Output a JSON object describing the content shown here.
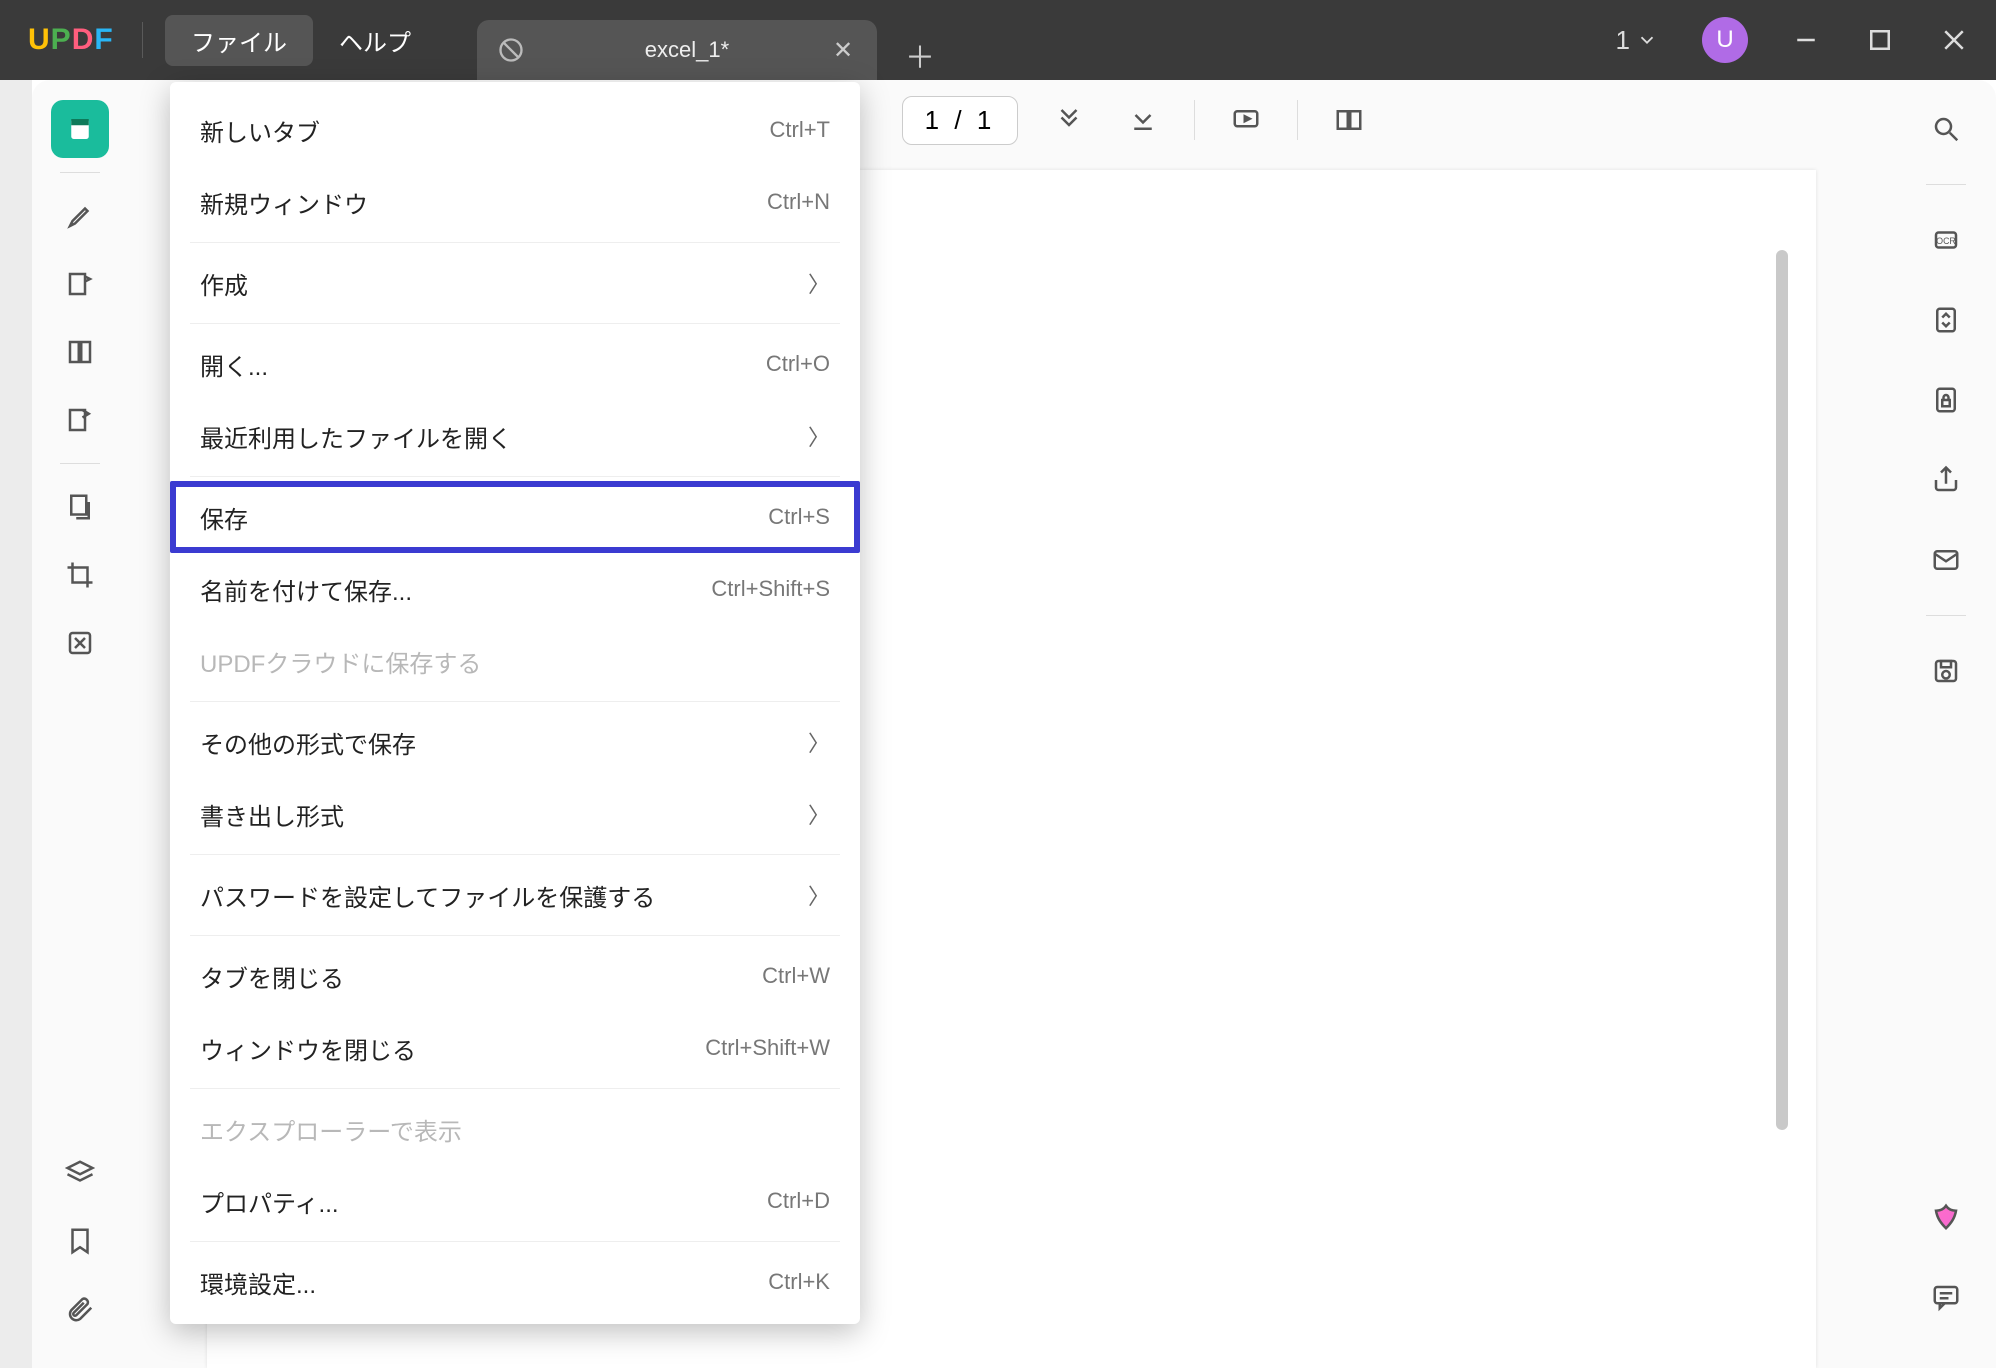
{
  "app": {
    "logo_chars": [
      "U",
      "P",
      "D",
      "F"
    ]
  },
  "menus": {
    "file": "ファイル",
    "help": "ヘルプ"
  },
  "tab": {
    "title": "excel_1*"
  },
  "title_right": {
    "count": "1",
    "avatar": "U"
  },
  "toolbar": {
    "page_current": "1",
    "page_sep": "/",
    "page_total": "1"
  },
  "dropdown": {
    "new_tab": {
      "label": "新しいタブ",
      "shortcut": "Ctrl+T"
    },
    "new_window": {
      "label": "新規ウィンドウ",
      "shortcut": "Ctrl+N"
    },
    "create": {
      "label": "作成"
    },
    "open": {
      "label": "開く...",
      "shortcut": "Ctrl+O"
    },
    "recent": {
      "label": "最近利用したファイルを開く"
    },
    "save": {
      "label": "保存",
      "shortcut": "Ctrl+S"
    },
    "save_as": {
      "label": "名前を付けて保存...",
      "shortcut": "Ctrl+Shift+S"
    },
    "save_cloud": {
      "label": "UPDFクラウドに保存する"
    },
    "save_other": {
      "label": "その他の形式で保存"
    },
    "export": {
      "label": "書き出し形式"
    },
    "protect": {
      "label": "パスワードを設定してファイルを保護する"
    },
    "close_tab": {
      "label": "タブを閉じる",
      "shortcut": "Ctrl+W"
    },
    "close_window": {
      "label": "ウィンドウを閉じる",
      "shortcut": "Ctrl+Shift+W"
    },
    "reveal": {
      "label": "エクスプローラーで表示"
    },
    "properties": {
      "label": "プロパティ...",
      "shortcut": "Ctrl+D"
    },
    "preferences": {
      "label": "環境設定...",
      "shortcut": "Ctrl+K"
    }
  }
}
